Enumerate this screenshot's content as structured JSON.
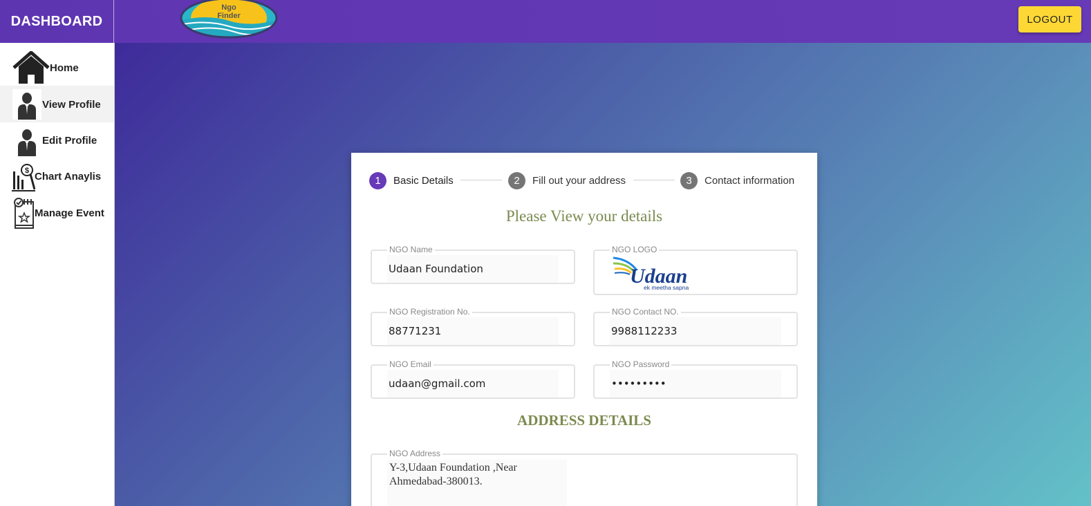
{
  "header": {
    "brand": "DASHBOARD",
    "logo_text": [
      "Ngo",
      "Finder"
    ],
    "logout_label": "LOGOUT"
  },
  "sidebar": {
    "items": [
      {
        "label": "Home",
        "icon": "home-icon"
      },
      {
        "label": "View Profile",
        "icon": "person-icon",
        "active": true
      },
      {
        "label": "Edit Profile",
        "icon": "person-icon"
      },
      {
        "label": "Chart Anaylis",
        "icon": "chart-icon"
      },
      {
        "label": "Manage Event",
        "icon": "calendar-icon"
      }
    ]
  },
  "stepper": {
    "steps": [
      {
        "number": "1",
        "label": "Basic Details",
        "active": true
      },
      {
        "number": "2",
        "label": "Fill out your address",
        "active": false
      },
      {
        "number": "3",
        "label": "Contact information",
        "active": false
      }
    ]
  },
  "form": {
    "heading": "Please View your details",
    "ngo_name": {
      "label": "NGO Name",
      "value": "Udaan Foundation"
    },
    "ngo_logo": {
      "label": "NGO LOGO",
      "logo_text": "Udaan",
      "tagline": "ek meetha sapna"
    },
    "registration_no": {
      "label": "NGO Registration No.",
      "value": "88771231"
    },
    "contact_no": {
      "label": "NGO Contact NO.",
      "value": "9988112233"
    },
    "email": {
      "label": "NGO Email",
      "value": "udaan@gmail.com"
    },
    "password": {
      "label": "NGO Password",
      "value": "•••••••••"
    },
    "address_heading": "ADDRESS DETAILS",
    "address": {
      "label": "NGO Address",
      "value": "Y-3,Udaan Foundation ,Near Ahmedabad-380013."
    }
  },
  "colors": {
    "header": "#673ab7",
    "logout_button": "#fdd835",
    "step_active": "#673ab7",
    "heading_text": "#7a8a4f"
  }
}
